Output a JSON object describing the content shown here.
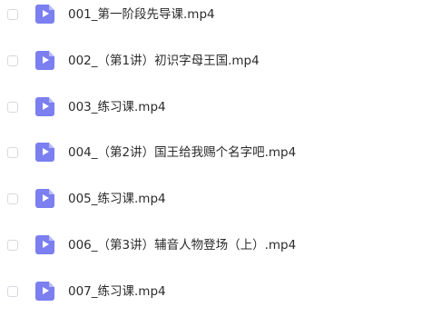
{
  "file_list": {
    "items": [
      {
        "name": "001_第一阶段先导课.mp4",
        "icon": "video-file-icon"
      },
      {
        "name": "002_（第1讲）初识字母王国.mp4",
        "icon": "video-file-icon"
      },
      {
        "name": "003_练习课.mp4",
        "icon": "video-file-icon"
      },
      {
        "name": "004_（第2讲）国王给我赐个名字吧.mp4",
        "icon": "video-file-icon"
      },
      {
        "name": "005_练习课.mp4",
        "icon": "video-file-icon"
      },
      {
        "name": "006_（第3讲）辅音人物登场（上）.mp4",
        "icon": "video-file-icon"
      },
      {
        "name": "007_练习课.mp4",
        "icon": "video-file-icon"
      }
    ],
    "colors": {
      "icon_accent": "#7b7ff0",
      "text": "#2b2b2b",
      "checkbox_border": "#d6d9de"
    }
  }
}
